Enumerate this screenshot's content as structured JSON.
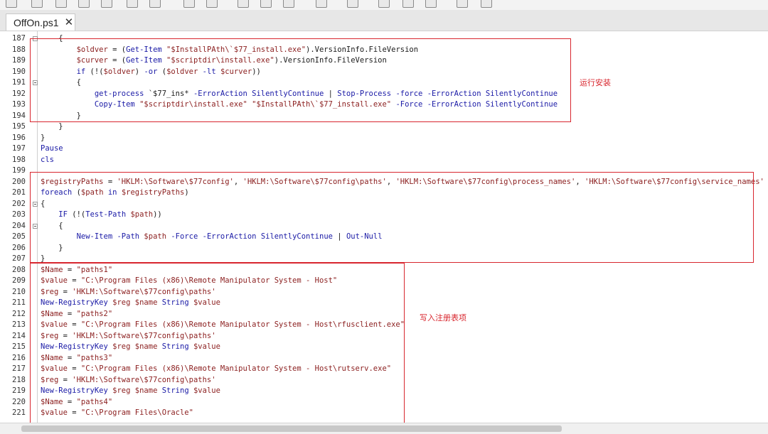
{
  "tab": {
    "title": "OffOn.ps1",
    "close_glyph": "✕"
  },
  "annotations": {
    "install": "运行安装",
    "registry": "写入注册表项"
  },
  "lines": [
    {
      "n": "187",
      "fold": true,
      "code": "    {"
    },
    {
      "n": "188",
      "fold": false,
      "code": "        $oldver = (Get-Item \"$InstallPAth\\`$77_install.exe\").VersionInfo.FileVersion"
    },
    {
      "n": "189",
      "fold": false,
      "code": "        $curver = (Get-Item \"$scriptdir\\install.exe\").VersionInfo.FileVersion"
    },
    {
      "n": "190",
      "fold": false,
      "code": "        if (!($oldver) -or ($oldver -lt $curver))"
    },
    {
      "n": "191",
      "fold": true,
      "code": "        {"
    },
    {
      "n": "192",
      "fold": false,
      "code": "            get-process `$77_ins* -ErrorAction SilentlyContinue | Stop-Process -force -ErrorAction SilentlyContinue"
    },
    {
      "n": "193",
      "fold": false,
      "code": "            Copy-Item \"$scriptdir\\install.exe\" \"$InstallPAth\\`$77_install.exe\" -Force -ErrorAction SilentlyContinue"
    },
    {
      "n": "194",
      "fold": false,
      "code": "        }"
    },
    {
      "n": "195",
      "fold": false,
      "code": "    }"
    },
    {
      "n": "196",
      "fold": false,
      "code": "}"
    },
    {
      "n": "197",
      "fold": false,
      "code": "Pause"
    },
    {
      "n": "198",
      "fold": false,
      "code": "cls"
    },
    {
      "n": "199",
      "fold": false,
      "code": ""
    },
    {
      "n": "200",
      "fold": false,
      "code": "$registryPaths = 'HKLM:\\Software\\$77config', 'HKLM:\\Software\\$77config\\paths', 'HKLM:\\Software\\$77config\\process_names', 'HKLM:\\Software\\$77config\\service_names'"
    },
    {
      "n": "201",
      "fold": false,
      "code": "foreach ($path in $registryPaths)"
    },
    {
      "n": "202",
      "fold": true,
      "code": "{"
    },
    {
      "n": "203",
      "fold": false,
      "code": "    IF (!(Test-Path $path))"
    },
    {
      "n": "204",
      "fold": true,
      "code": "    {"
    },
    {
      "n": "205",
      "fold": false,
      "code": "        New-Item -Path $path -Force -ErrorAction SilentlyContinue | Out-Null"
    },
    {
      "n": "206",
      "fold": false,
      "code": "    }"
    },
    {
      "n": "207",
      "fold": false,
      "code": "}"
    },
    {
      "n": "208",
      "fold": false,
      "code": "$Name = \"paths1\""
    },
    {
      "n": "209",
      "fold": false,
      "code": "$value = \"C:\\Program Files (x86)\\Remote Manipulator System - Host\""
    },
    {
      "n": "210",
      "fold": false,
      "code": "$reg = 'HKLM:\\Software\\$77config\\paths'"
    },
    {
      "n": "211",
      "fold": false,
      "code": "New-RegistryKey $reg $name String $value"
    },
    {
      "n": "212",
      "fold": false,
      "code": "$Name = \"paths2\""
    },
    {
      "n": "213",
      "fold": false,
      "code": "$value = \"C:\\Program Files (x86)\\Remote Manipulator System - Host\\rfusclient.exe\""
    },
    {
      "n": "214",
      "fold": false,
      "code": "$reg = 'HKLM:\\Software\\$77config\\paths'"
    },
    {
      "n": "215",
      "fold": false,
      "code": "New-RegistryKey $reg $name String $value"
    },
    {
      "n": "216",
      "fold": false,
      "code": "$Name = \"paths3\""
    },
    {
      "n": "217",
      "fold": false,
      "code": "$value = \"C:\\Program Files (x86)\\Remote Manipulator System - Host\\rutserv.exe\""
    },
    {
      "n": "218",
      "fold": false,
      "code": "$reg = 'HKLM:\\Software\\$77config\\paths'"
    },
    {
      "n": "219",
      "fold": false,
      "code": "New-RegistryKey $reg $name String $value"
    },
    {
      "n": "220",
      "fold": false,
      "code": "$Name = \"paths4\""
    },
    {
      "n": "221",
      "fold": false,
      "code": "$value = \"C:\\Program Files\\Oracle\""
    }
  ]
}
